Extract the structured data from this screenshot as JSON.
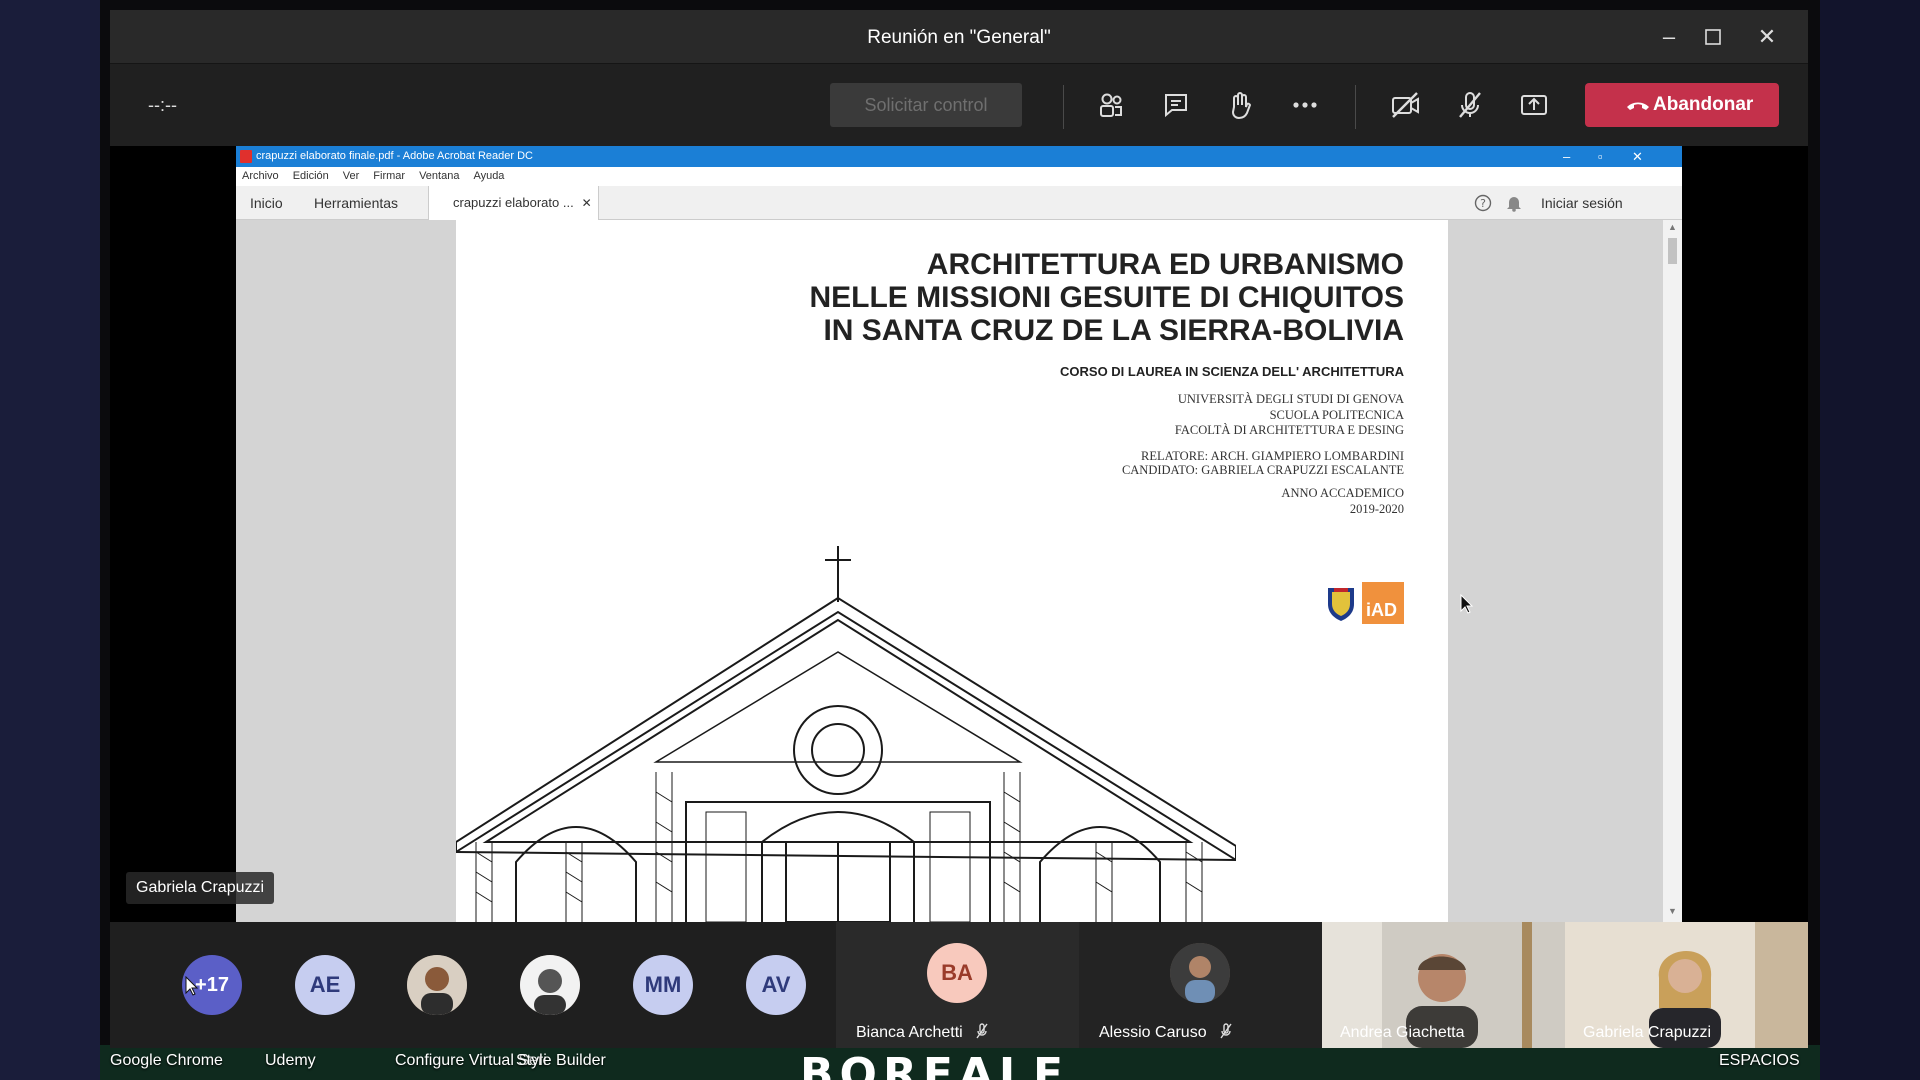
{
  "window": {
    "title": "Reunión en \"General\""
  },
  "call_bar": {
    "timer": "--:--",
    "request_control_label": "Solicitar control",
    "leave_label": "Abandonar"
  },
  "acrobat": {
    "title": "crapuzzi elaborato finale.pdf - Adobe Acrobat Reader DC",
    "menu": [
      "Archivo",
      "Edición",
      "Ver",
      "Firmar",
      "Ventana",
      "Ayuda"
    ],
    "tabs": {
      "home": "Inicio",
      "tools": "Herramientas",
      "document": "crapuzzi elaborato ..."
    },
    "sign_in": "Iniciar sesión"
  },
  "document": {
    "title_lines": [
      "ARCHITETTURA ED URBANISMO",
      "NELLE MISSIONI GESUITE DI CHIQUITOS",
      "IN SANTA CRUZ DE LA SIERRA-BOLIVIA"
    ],
    "course": "CORSO DI LAUREA IN SCIENZA DELL' ARCHITETTURA",
    "institution": [
      "UNIVERSITÀ DEGLI STUDI DI GENOVA",
      "SCUOLA POLITECNICA",
      "FACOLTÀ DI ARCHITETTURA E DESING"
    ],
    "people": [
      "RELATORE: ARCH. GIAMPIERO LOMBARDINI",
      "CANDIDATO: GABRIELA CRAPUZZI ESCALANTE"
    ],
    "year": [
      "ANNO ACCADEMICO",
      "2019-2020"
    ],
    "logo_text": "iAD"
  },
  "speaker_label": "Gabriela Crapuzzi",
  "participants": {
    "overflow": "+17",
    "avatars": [
      "AE",
      "MM",
      "AV"
    ],
    "tiles": [
      {
        "initials": "BA",
        "name": "Bianca Archetti"
      },
      {
        "name": "Alessio Caruso"
      },
      {
        "name": "Andrea Giachetta"
      },
      {
        "name": "Gabriela Crapuzzi"
      }
    ]
  },
  "desktop": {
    "icons": [
      "Google Chrome",
      "Udemy",
      "Configure Virtual Seri",
      "Style Builder",
      "ESPACIOS"
    ],
    "banner": "BOREALE"
  },
  "colors": {
    "leave": "#c4314b",
    "acrobat_title": "#1b7fd6",
    "avatar_more": "#5b5fc7"
  }
}
